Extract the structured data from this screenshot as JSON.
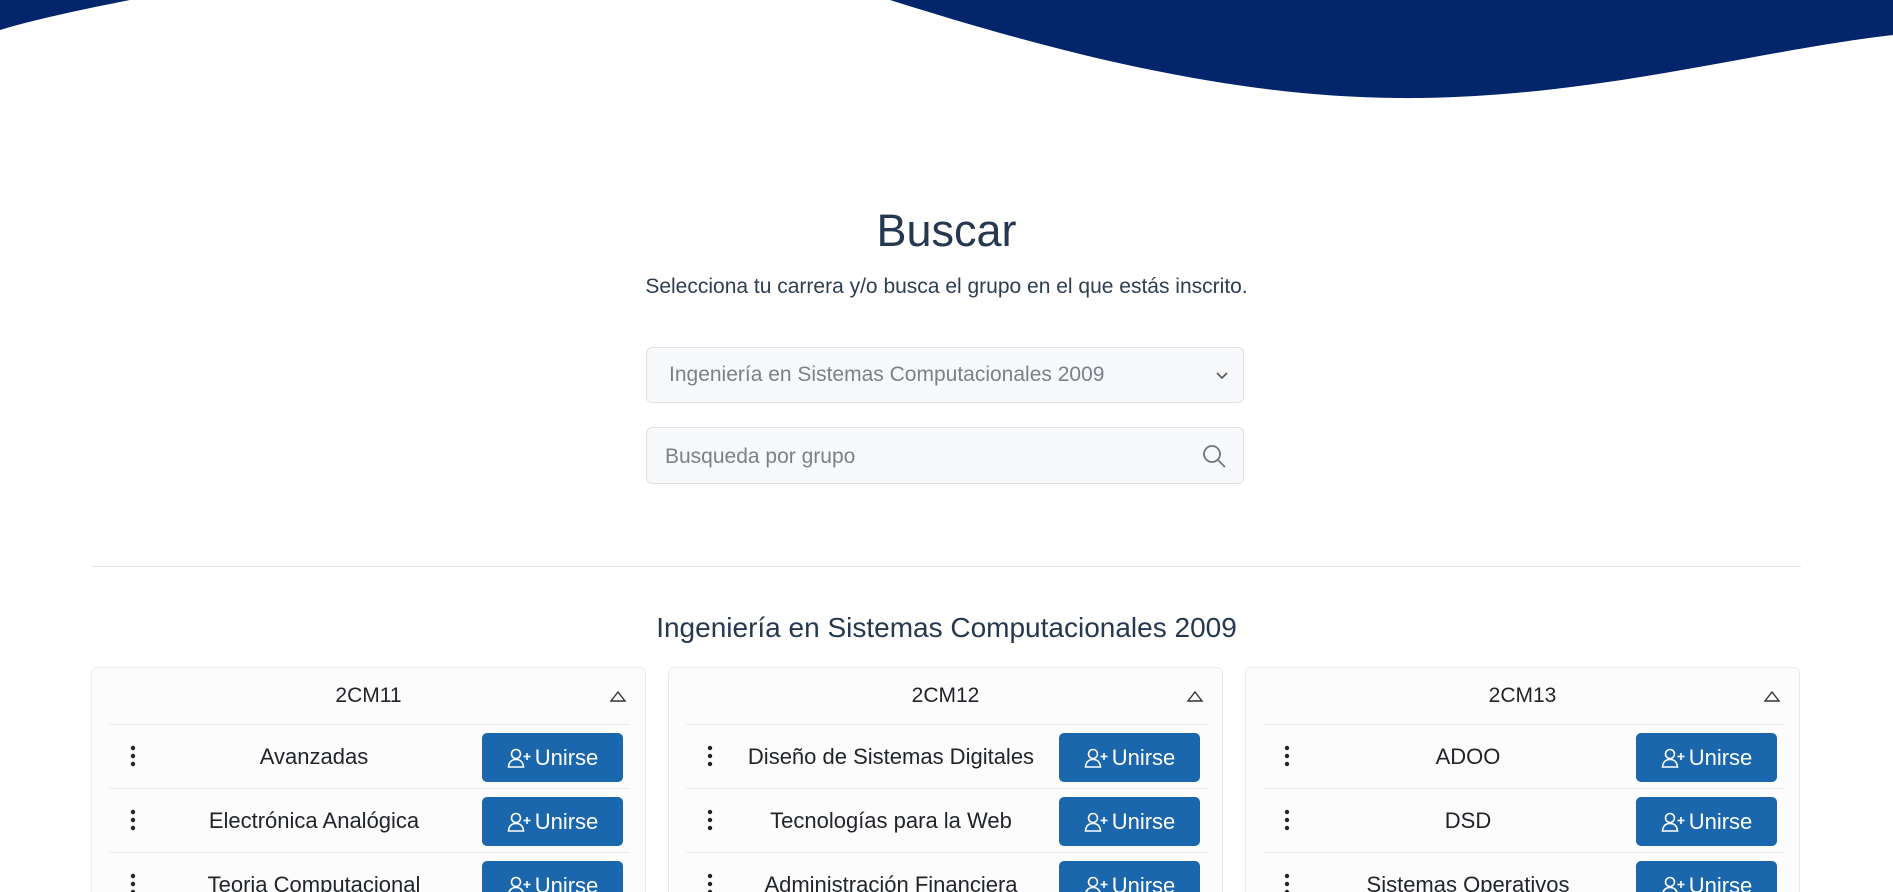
{
  "page": {
    "title": "Buscar",
    "subtitle": "Selecciona tu carrera y/o busca el grupo en el que estás inscrito."
  },
  "filters": {
    "career_select_value": "Ingeniería en Sistemas Computacionales 2009",
    "search_placeholder": "Busqueda por grupo"
  },
  "section": {
    "title": "Ingeniería en Sistemas Computacionales 2009"
  },
  "colors": {
    "header_wave": "#03256c",
    "join_button": "#1a67ad"
  },
  "groups": [
    {
      "name": "2CM11",
      "subjects": [
        {
          "name": "Avanzadas",
          "action": "Unirse"
        },
        {
          "name": "Electrónica Analógica",
          "action": "Unirse"
        },
        {
          "name": "Teoria Computacional",
          "action": "Unirse"
        }
      ]
    },
    {
      "name": "2CM12",
      "subjects": [
        {
          "name": "Diseño de Sistemas Digitales",
          "action": "Unirse"
        },
        {
          "name": "Tecnologías para la Web",
          "action": "Unirse"
        },
        {
          "name": "Administración Financiera",
          "action": "Unirse"
        }
      ]
    },
    {
      "name": "2CM13",
      "subjects": [
        {
          "name": "ADOO",
          "action": "Unirse"
        },
        {
          "name": "DSD",
          "action": "Unirse"
        },
        {
          "name": "Sistemas Operativos",
          "action": "Unirse"
        }
      ]
    }
  ]
}
